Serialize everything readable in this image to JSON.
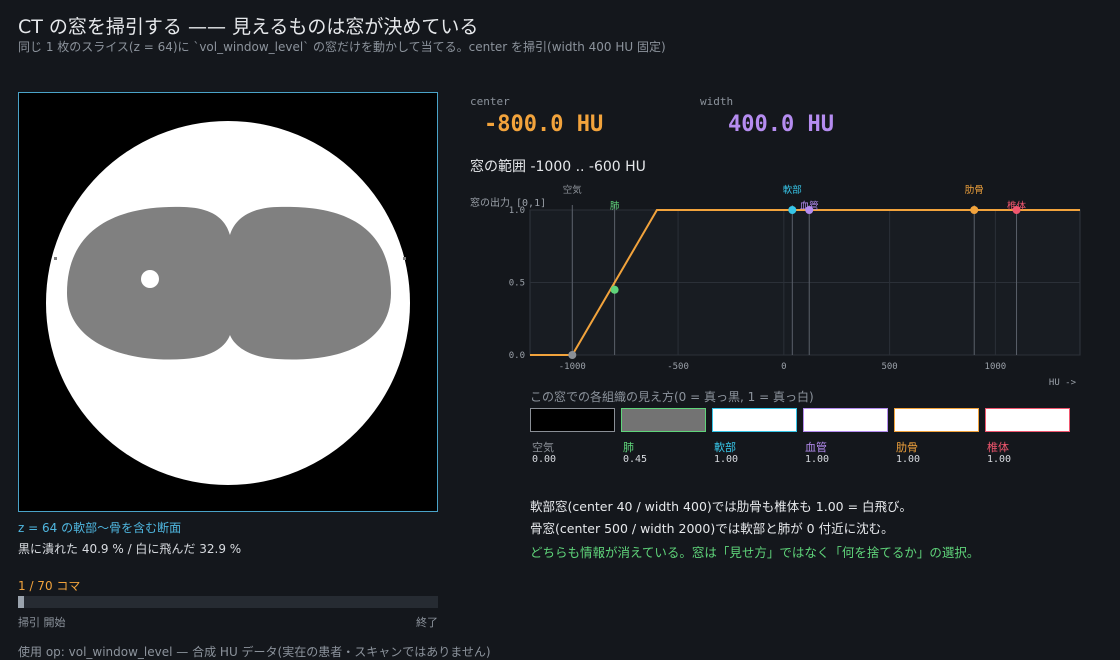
{
  "header": {
    "title": "CT の窓を掃引する —— 見えるものは窓が決めている",
    "subtitle": "同じ 1 枚のスライス(z = 64)に `vol_window_level` の窓だけを動かして当てる。center を掃引(width 400 HU 固定)"
  },
  "slice": {
    "caption": "z = 64 の軟部〜骨を含む断面",
    "stats": "黒に潰れた 40.9 % / 白に飛んだ 32.9 %"
  },
  "playback": {
    "frame_counter": "1 / 70 コマ",
    "progress_fraction": 0.0143,
    "start_label": "掃引 開始",
    "end_label": "終了"
  },
  "footer": "使用 op: vol_window_level — 合成 HU データ(実在の患者・スキャンではありません)",
  "window": {
    "center_label": "center",
    "center_value": "-800.0 HU",
    "width_label": "width",
    "width_value": "400.0 HU",
    "range_text": "窓の範囲 -1000 .. -600 HU"
  },
  "colors": {
    "center": "#f2a33c",
    "width": "#b58cf0",
    "curve": "#f2a33c",
    "note_highlight": "#5fd47a"
  },
  "chart_data": {
    "type": "line",
    "ylabel": "窓の出力 [0,1]",
    "xlabel": "HU ->",
    "xlim": [
      -1200,
      1400
    ],
    "ylim": [
      0,
      1
    ],
    "xticks": [
      -1000,
      -500,
      0,
      500,
      1000
    ],
    "yticks": [
      0.0,
      0.5,
      1.0
    ],
    "xtick_labels": [
      "-1000",
      "-500",
      "0",
      "500",
      "1000"
    ],
    "ytick_labels": [
      "0.0",
      "0.5",
      "1.0"
    ],
    "grid": true,
    "curve": {
      "x": [
        -1200,
        -1000,
        -600,
        1400
      ],
      "y": [
        0,
        0,
        1,
        1
      ]
    },
    "markers": [
      {
        "name": "空気",
        "hu": -1000,
        "value": 0.0,
        "color": "#8a8f96",
        "label_row": 0
      },
      {
        "name": "肺",
        "hu": -800,
        "value": 0.45,
        "color": "#5fd47a",
        "label_row": 1
      },
      {
        "name": "軟部",
        "hu": 40,
        "value": 1.0,
        "color": "#37c6e8",
        "label_row": 0
      },
      {
        "name": "血管",
        "hu": 120,
        "value": 1.0,
        "color": "#b58cf0",
        "label_row": 1
      },
      {
        "name": "肋骨",
        "hu": 900,
        "value": 1.0,
        "color": "#f2a33c",
        "label_row": 0
      },
      {
        "name": "椎体",
        "hu": 1100,
        "value": 1.0,
        "color": "#f0566e",
        "label_row": 1
      }
    ]
  },
  "swatches": {
    "title": "この窓での各組織の見え方(0 = 真っ黒, 1 = 真っ白)",
    "items": [
      {
        "name": "空気",
        "value": "0.00",
        "level": 0.0,
        "color": "#8a8f96"
      },
      {
        "name": "肺",
        "value": "0.45",
        "level": 0.45,
        "color": "#5fd47a"
      },
      {
        "name": "軟部",
        "value": "1.00",
        "level": 1.0,
        "color": "#37c6e8"
      },
      {
        "name": "血管",
        "value": "1.00",
        "level": 1.0,
        "color": "#b58cf0"
      },
      {
        "name": "肋骨",
        "value": "1.00",
        "level": 1.0,
        "color": "#f2a33c"
      },
      {
        "name": "椎体",
        "value": "1.00",
        "level": 1.0,
        "color": "#f0566e"
      }
    ]
  },
  "notes": {
    "line1": "軟部窓(center 40 / width 400)では肋骨も椎体も 1.00 = 白飛び。",
    "line2": "骨窓(center 500 / width 2000)では軟部と肺が 0 付近に沈む。",
    "line3": "どちらも情報が消えている。窓は「見せ方」ではなく「何を捨てるか」の選択。"
  }
}
